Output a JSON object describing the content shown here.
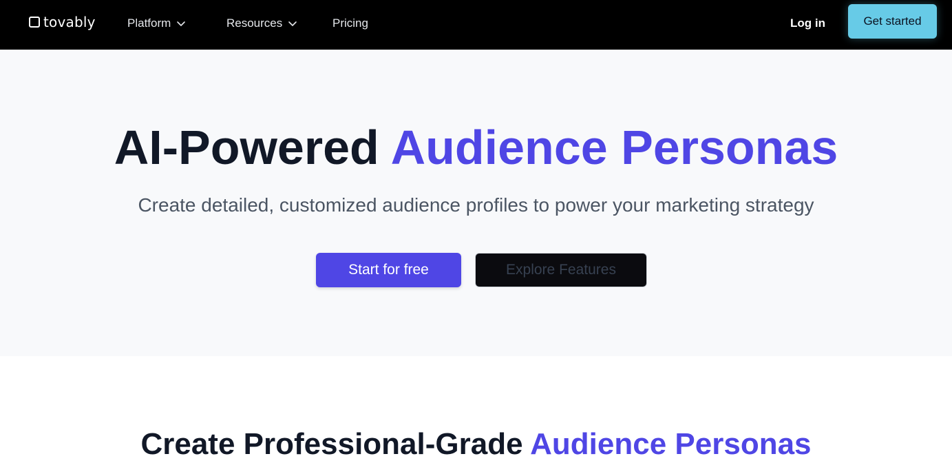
{
  "brand": {
    "name": "tovably",
    "icon": "square-logo-icon"
  },
  "nav": {
    "items": [
      {
        "label": "Platform",
        "has_dropdown": true
      },
      {
        "label": "Resources",
        "has_dropdown": true
      },
      {
        "label": "Pricing",
        "has_dropdown": false
      }
    ],
    "login_label": "Log in",
    "get_started_label": "Get started"
  },
  "hero": {
    "title_main": "AI-Powered ",
    "title_accent": "Audience Personas",
    "subtitle": "Create detailed, customized audience profiles to power your marketing strategy",
    "primary_button": "Start for free",
    "secondary_button": "Explore Features"
  },
  "section2": {
    "title_main": "Create Professional-Grade ",
    "title_accent": "Audience Personas"
  },
  "colors": {
    "navbar_bg": "#000000",
    "accent": "#4f46e5",
    "cta_cyan": "#67cbe7",
    "hero_bg": "#f8f9fb",
    "heading": "#111827"
  }
}
